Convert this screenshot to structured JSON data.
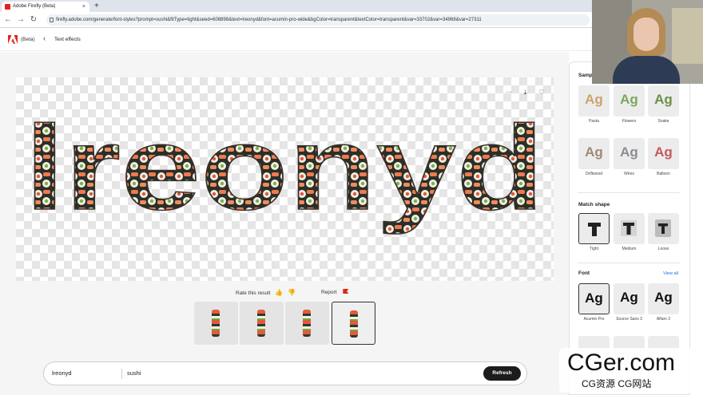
{
  "browser": {
    "tab_title": "Adobe Firefly (Beta)",
    "tab_close": "×",
    "new_tab": "+",
    "url": "firefly.adobe.com/generate/font-styles?prompt=sushi&fitType=tight&seed=608898&text=lreonyd&font=acumin-pro-wide&bgColor=transparent&textColor=transparent&var=33702&var=34968&var=27311",
    "back_icon": "←",
    "forward_icon": "→",
    "reload_icon": "↻"
  },
  "header": {
    "beta_label": "(Beta)",
    "back_icon": "‹",
    "breadcrumb": "Text effects"
  },
  "canvas": {
    "more_icon": "···",
    "download_icon": "⤓",
    "favorite_icon": "♡",
    "preview_text": "lreonyd",
    "rate_label": "Rate this result",
    "thumbs_up": "👍",
    "thumbs_down": "👎",
    "report_label": "Report"
  },
  "thumbnails": [
    {
      "selected": false
    },
    {
      "selected": false
    },
    {
      "selected": false
    },
    {
      "selected": true
    }
  ],
  "prompt_bar": {
    "text_value": "lreonyd",
    "prompt_value": "sushi",
    "refresh_label": "Refresh"
  },
  "panel": {
    "samples_title": "Samp",
    "samples": [
      {
        "label": "Pasta",
        "glyph": "Ag",
        "color": "#c9a36a"
      },
      {
        "label": "Flowers",
        "glyph": "Ag",
        "color": "#7aa85a"
      },
      {
        "label": "Snake",
        "glyph": "Ag",
        "color": "#6c8f46"
      },
      {
        "label": "Driftwood",
        "glyph": "Ag",
        "color": "#9d8b74"
      },
      {
        "label": "Wires",
        "glyph": "Ag",
        "color": "#8c8c94"
      },
      {
        "label": "Balloon",
        "glyph": "Ag",
        "color": "#c45a5a"
      }
    ],
    "match_shape_title": "Match shape",
    "shapes": [
      {
        "label": "Tight",
        "selected": true
      },
      {
        "label": "Medium",
        "selected": false
      },
      {
        "label": "Loose",
        "selected": false
      }
    ],
    "font_title": "Font",
    "view_all": "View all",
    "fonts": [
      {
        "label": "Acumin Pro",
        "glyph": "Ag",
        "selected": true
      },
      {
        "label": "Source Sans 3",
        "glyph": "Ag",
        "selected": false
      },
      {
        "label": "Alfarn 2",
        "glyph": "Ag",
        "selected": false
      }
    ]
  },
  "watermark": {
    "big": "CGer.com",
    "small": "CG资源 CG网站"
  },
  "colors": {
    "adobe_red": "#e1251b",
    "dark_button": "#1c1c1c",
    "link_blue": "#1473e6"
  }
}
